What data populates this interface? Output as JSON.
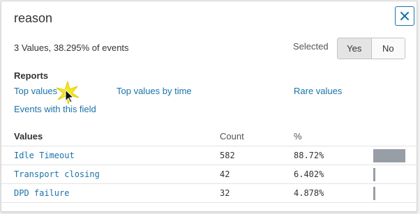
{
  "title": "reason",
  "summary": "3 Values, 38.295% of events",
  "selected": {
    "label": "Selected",
    "options": [
      "Yes",
      "No"
    ],
    "active": "Yes"
  },
  "reports": {
    "heading": "Reports",
    "links": {
      "top_values": "Top values",
      "top_values_by_time": "Top values by time",
      "rare_values": "Rare values",
      "events_with_field": "Events with this field"
    }
  },
  "table": {
    "headers": {
      "values": "Values",
      "count": "Count",
      "percent": "%"
    },
    "rows": [
      {
        "value": "Idle Timeout",
        "count": "582",
        "percent": "88.72%",
        "fraction": 0.8872
      },
      {
        "value": "Transport closing",
        "count": "42",
        "percent": "6.402%",
        "fraction": 0.06402
      },
      {
        "value": "DPD failure",
        "count": "32",
        "percent": "4.878%",
        "fraction": 0.04878
      }
    ]
  },
  "icons": {
    "close": "close-icon",
    "cursor": "mouse-pointer-icon"
  },
  "colors": {
    "link": "#1a73a8",
    "bar": "#979ea6"
  }
}
